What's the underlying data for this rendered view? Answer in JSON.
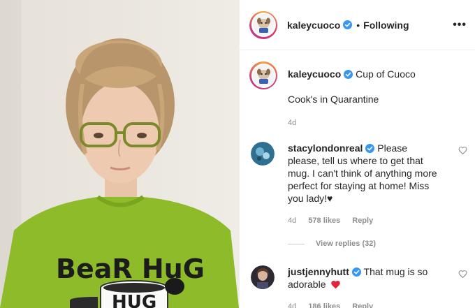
{
  "post": {
    "author": "kaleycuoco",
    "follow_separator": "•",
    "follow_status": "Following",
    "more_label": "•••",
    "photo": {
      "shirt_text_line1": "BeaR HuG",
      "mug_text": "HUG"
    }
  },
  "caption": {
    "username": "kaleycuoco",
    "title": "Cup of Cuoco",
    "line2": "Cook's in Quarantine",
    "age": "4d"
  },
  "comments": [
    {
      "username": "stacylondonreal",
      "text": "Please please, tell us where to get that mug. I can't think of anything more perfect for staying at home! Miss you lady!♥",
      "age": "4d",
      "likes": "578 likes",
      "reply_label": "Reply"
    },
    {
      "username": "justjennyhutt",
      "text": "That mug is so adorable",
      "age": "4d",
      "likes": "186 likes",
      "reply_label": "Reply"
    }
  ],
  "view_replies": "View replies (32)",
  "colors": {
    "verified_blue": "#3897f0",
    "heart_red": "#ed4956",
    "shirt_green": "#8dbb2a"
  }
}
